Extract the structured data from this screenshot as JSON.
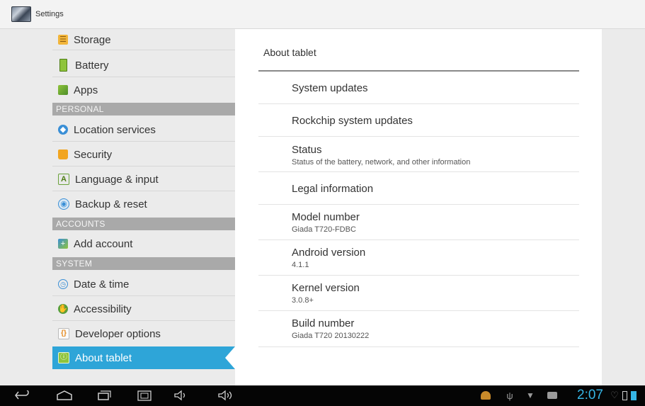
{
  "titlebar": {
    "title": "Settings"
  },
  "sidebar": {
    "items": [
      {
        "label": "Storage",
        "icon": "storage-icon"
      },
      {
        "label": "Battery",
        "icon": "battery-icon"
      },
      {
        "label": "Apps",
        "icon": "apps-icon"
      },
      {
        "header": "PERSONAL"
      },
      {
        "label": "Location services",
        "icon": "location-icon"
      },
      {
        "label": "Security",
        "icon": "lock-icon"
      },
      {
        "label": "Language & input",
        "icon": "language-icon"
      },
      {
        "label": "Backup & reset",
        "icon": "backup-icon"
      },
      {
        "header": "ACCOUNTS"
      },
      {
        "label": "Add account",
        "icon": "add-account-icon"
      },
      {
        "header": "SYSTEM"
      },
      {
        "label": "Date & time",
        "icon": "clock-icon"
      },
      {
        "label": "Accessibility",
        "icon": "accessibility-icon"
      },
      {
        "label": "Developer options",
        "icon": "developer-icon"
      },
      {
        "label": "About tablet",
        "icon": "info-icon",
        "selected": true
      }
    ]
  },
  "main": {
    "title": "About tablet",
    "prefs": [
      {
        "title": "System updates",
        "summary": ""
      },
      {
        "title": "Rockchip system updates",
        "summary": ""
      },
      {
        "title": "Status",
        "summary": "Status of the battery, network, and other information"
      },
      {
        "title": "Legal information",
        "summary": ""
      },
      {
        "title": "Model number",
        "summary": "Giada T720-FDBC"
      },
      {
        "title": "Android version",
        "summary": "4.1.1"
      },
      {
        "title": "Kernel version",
        "summary": "3.0.8+"
      },
      {
        "title": "Build number",
        "summary": "Giada T720 20130222"
      }
    ]
  },
  "statusbar": {
    "time": "2:07",
    "accent": "#35b5e5"
  }
}
